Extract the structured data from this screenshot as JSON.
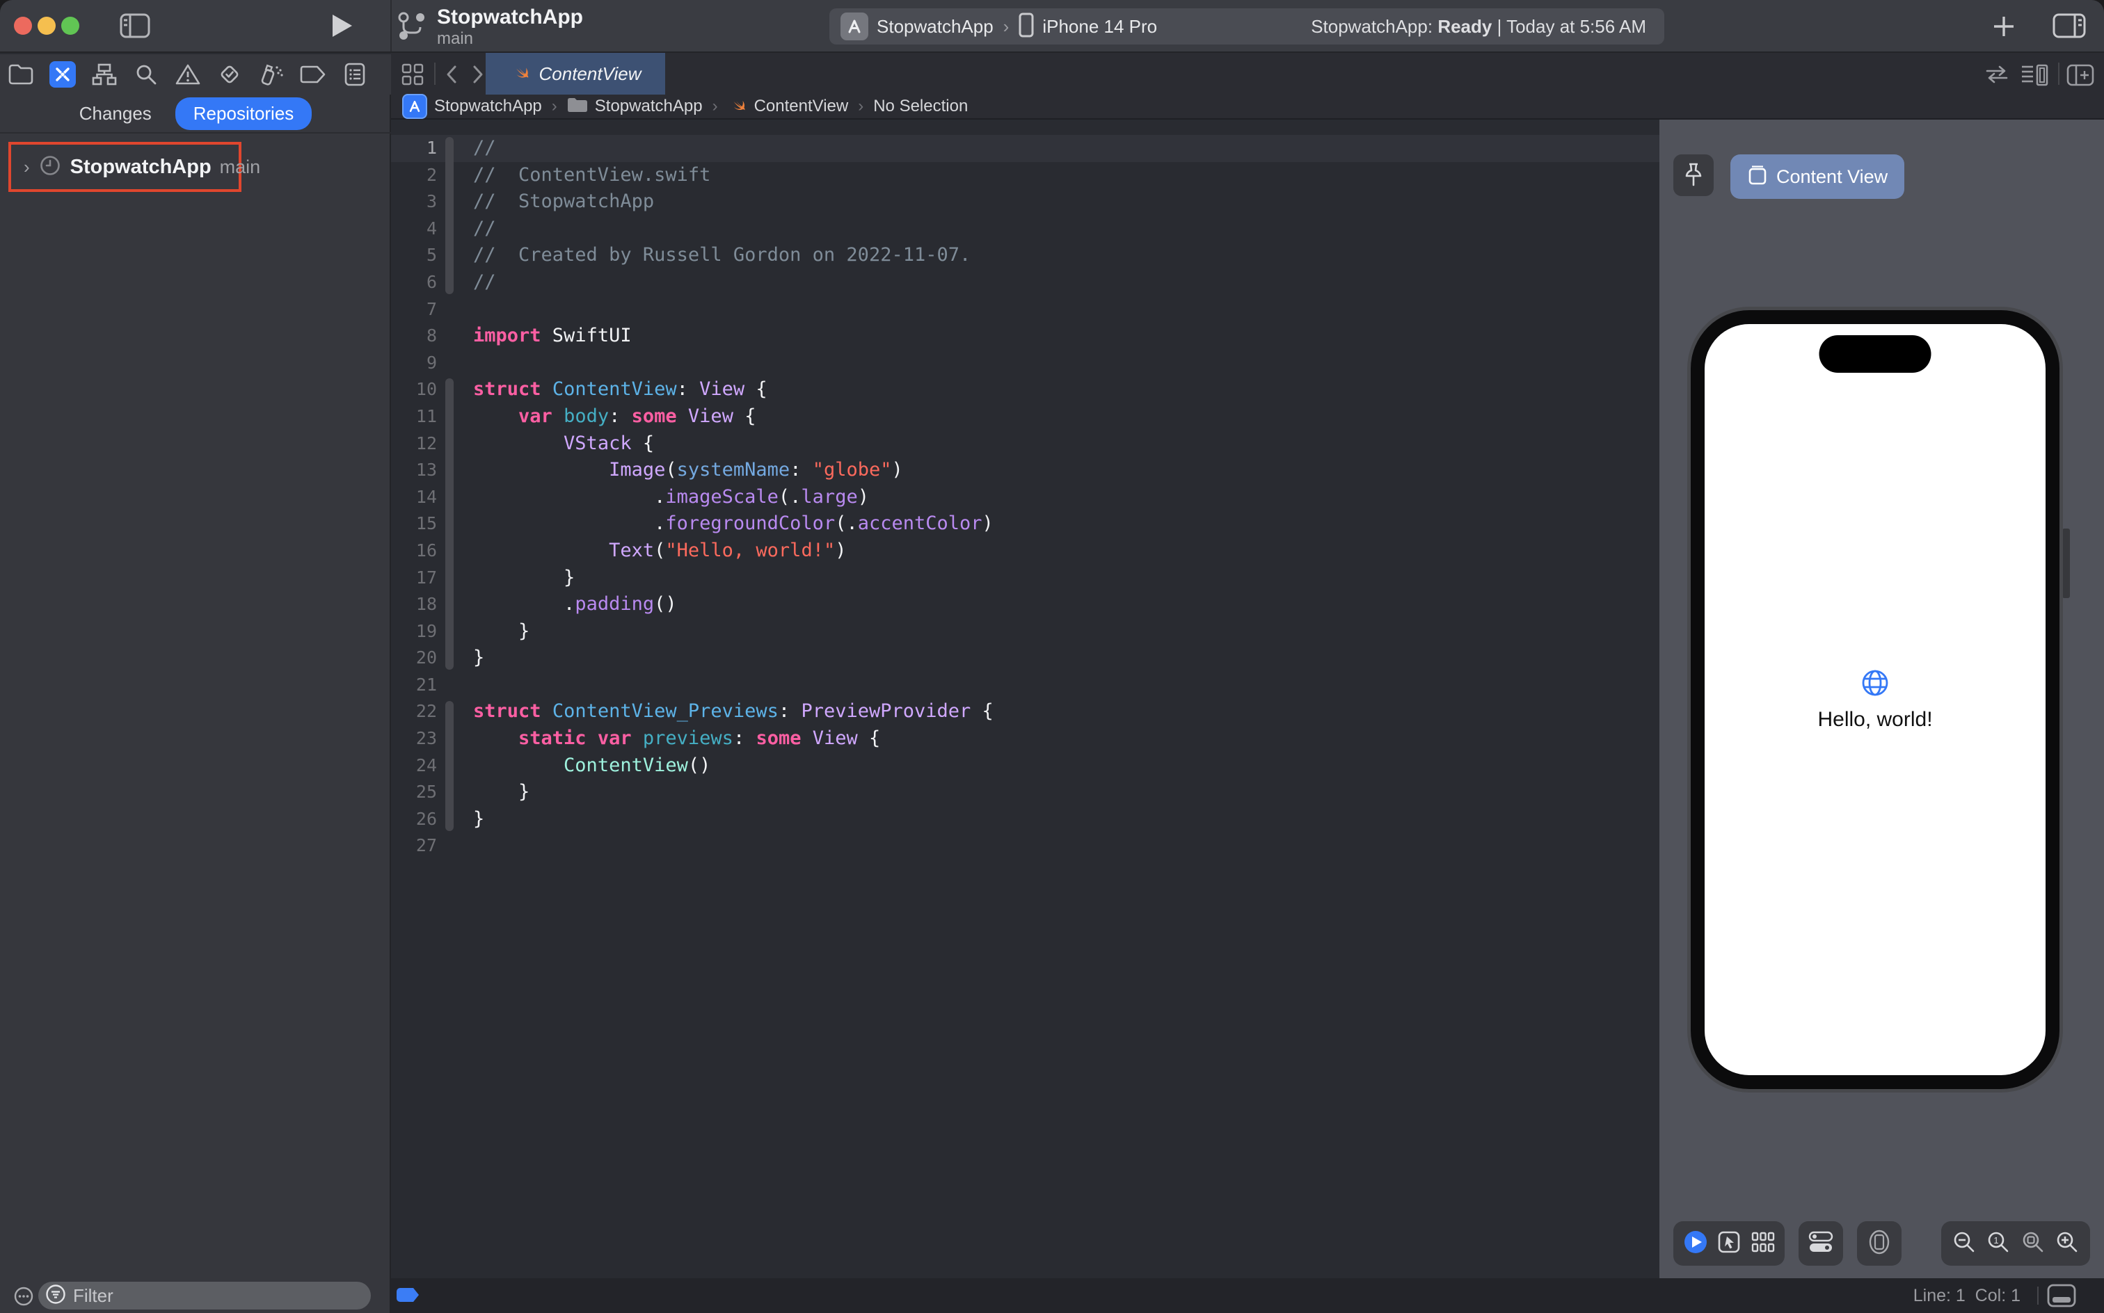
{
  "toolbar": {
    "project": "StopwatchApp",
    "branch": "main",
    "scheme": "StopwatchApp",
    "run_destination": "iPhone 14 Pro",
    "status_prefix": "StopwatchApp: ",
    "status_state": "Ready",
    "status_rest": " | Today at 5:56 AM"
  },
  "navigator": {
    "tab_changes": "Changes",
    "tab_repositories": "Repositories",
    "repo_name": "StopwatchApp",
    "repo_branch": "main",
    "annotation_color": "#E0462E"
  },
  "filter": {
    "placeholder": "Filter"
  },
  "editor": {
    "tab": "ContentView",
    "breadcrumbs": [
      "StopwatchApp",
      "StopwatchApp",
      "ContentView",
      "No Selection"
    ],
    "current_line": 1,
    "fold_ribbons": [
      [
        1,
        6
      ],
      [
        10,
        20
      ],
      [
        22,
        26
      ]
    ],
    "code_lines": [
      [
        [
          "cm",
          "//"
        ]
      ],
      [
        [
          "cm",
          "//  ContentView.swift"
        ]
      ],
      [
        [
          "cm",
          "//  StopwatchApp"
        ]
      ],
      [
        [
          "cm",
          "//"
        ]
      ],
      [
        [
          "cm",
          "//  Created by Russell Gordon on 2022-11-07."
        ]
      ],
      [
        [
          "cm",
          "//"
        ]
      ],
      [],
      [
        [
          "kw",
          "import"
        ],
        [
          "pl",
          " SwiftUI"
        ]
      ],
      [],
      [
        [
          "kw",
          "struct"
        ],
        [
          "pl",
          " "
        ],
        [
          "de",
          "ContentView"
        ],
        [
          "pl",
          ": "
        ],
        [
          "ty",
          "View"
        ],
        [
          "pl",
          " {"
        ]
      ],
      [
        [
          "pl",
          "    "
        ],
        [
          "kw",
          "var"
        ],
        [
          "pl",
          " "
        ],
        [
          "pr",
          "body"
        ],
        [
          "pl",
          ": "
        ],
        [
          "kw",
          "some"
        ],
        [
          "pl",
          " "
        ],
        [
          "ty",
          "View"
        ],
        [
          "pl",
          " {"
        ]
      ],
      [
        [
          "pl",
          "        "
        ],
        [
          "ty",
          "VStack"
        ],
        [
          "pl",
          " {"
        ]
      ],
      [
        [
          "pl",
          "            "
        ],
        [
          "ty",
          "Image"
        ],
        [
          "pl",
          "("
        ],
        [
          "arg",
          "systemName"
        ],
        [
          "pl",
          ": "
        ],
        [
          "str",
          "\"globe\""
        ],
        [
          "pl",
          ")"
        ]
      ],
      [
        [
          "pl",
          "                ."
        ],
        [
          "fn",
          "imageScale"
        ],
        [
          "pl",
          "(."
        ],
        [
          "fn",
          "large"
        ],
        [
          "pl",
          ")"
        ]
      ],
      [
        [
          "pl",
          "                ."
        ],
        [
          "fn",
          "foregroundColor"
        ],
        [
          "pl",
          "(."
        ],
        [
          "fn",
          "accentColor"
        ],
        [
          "pl",
          ")"
        ]
      ],
      [
        [
          "pl",
          "            "
        ],
        [
          "ty",
          "Text"
        ],
        [
          "pl",
          "("
        ],
        [
          "str",
          "\"Hello, world!\""
        ],
        [
          "pl",
          ")"
        ]
      ],
      [
        [
          "pl",
          "        }"
        ]
      ],
      [
        [
          "pl",
          "        ."
        ],
        [
          "fn",
          "padding"
        ],
        [
          "pl",
          "()"
        ]
      ],
      [
        [
          "pl",
          "    }"
        ]
      ],
      [
        [
          "pl",
          "}"
        ]
      ],
      [],
      [
        [
          "kw",
          "struct"
        ],
        [
          "pl",
          " "
        ],
        [
          "de",
          "ContentView_Previews"
        ],
        [
          "pl",
          ": "
        ],
        [
          "ty",
          "PreviewProvider"
        ],
        [
          "pl",
          " {"
        ]
      ],
      [
        [
          "pl",
          "    "
        ],
        [
          "kw",
          "static"
        ],
        [
          "pl",
          " "
        ],
        [
          "kw",
          "var"
        ],
        [
          "pl",
          " "
        ],
        [
          "pr",
          "previews"
        ],
        [
          "pl",
          ": "
        ],
        [
          "kw",
          "some"
        ],
        [
          "pl",
          " "
        ],
        [
          "ty",
          "View"
        ],
        [
          "pl",
          " {"
        ]
      ],
      [
        [
          "pl",
          "        "
        ],
        [
          "mint",
          "ContentView"
        ],
        [
          "pl",
          "()"
        ]
      ],
      [
        [
          "pl",
          "    }"
        ]
      ],
      [
        [
          "pl",
          "}"
        ]
      ],
      []
    ]
  },
  "canvas": {
    "preview_button": "Content View",
    "preview_text": "Hello, world!",
    "accent_color": "#3478F6"
  },
  "statusbar": {
    "line_col": "Line: 1  Col: 1"
  }
}
